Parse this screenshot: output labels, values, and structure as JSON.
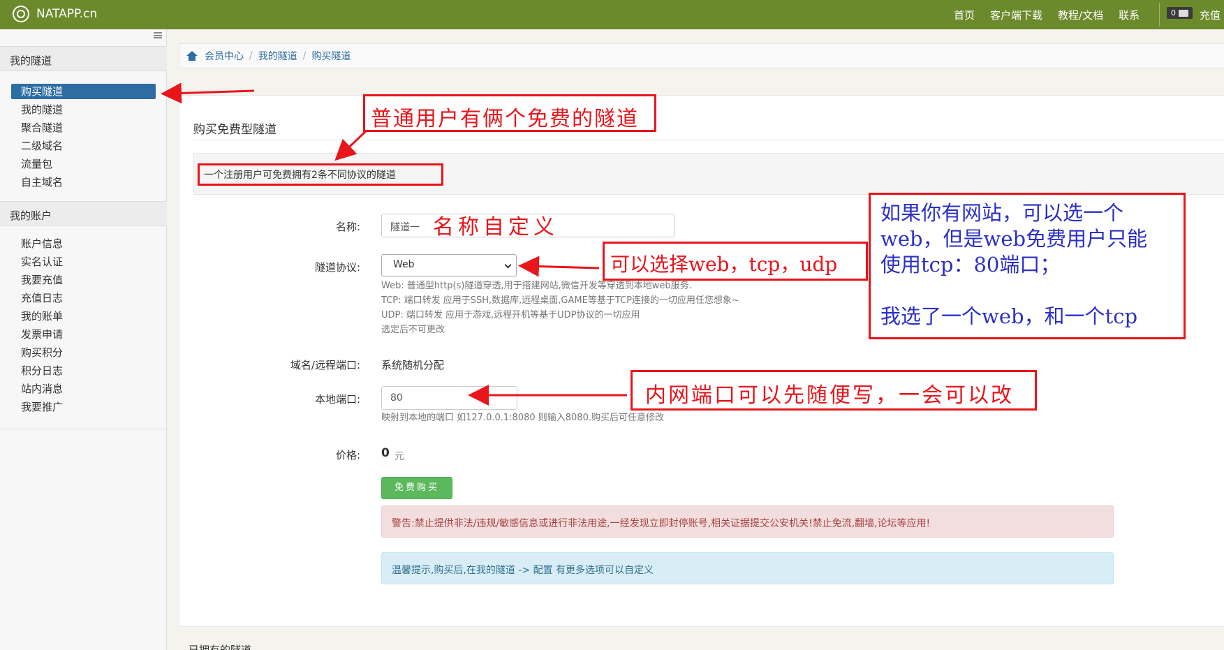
{
  "topbar": {
    "brand": "NATAPP.cn",
    "nav": [
      "首页",
      "客户端下载",
      "教程/文档",
      "联系"
    ],
    "badge_count": "0",
    "recharge": "充值"
  },
  "sidebar": {
    "section1": "我的隧道",
    "items1": [
      "购买隧道",
      "我的隧道",
      "聚合隧道",
      "二级域名",
      "流量包",
      "自主域名"
    ],
    "section2": "我的账户",
    "items2": [
      "账户信息",
      "实名认证",
      "我要充值",
      "充值日志",
      "我的账单",
      "发票申请",
      "购买积分",
      "积分日志",
      "站内消息",
      "我要推广"
    ]
  },
  "breadcrumb": [
    "会员中心",
    "我的隧道",
    "购买隧道"
  ],
  "form": {
    "title": "购买免费型隧道",
    "info": "一个注册用户可免费拥有2条不同协议的隧道",
    "name_label": "名称:",
    "name_value": "隧道一",
    "protocol_label": "隧道协议:",
    "protocol_value": "Web",
    "protocol_help": [
      "Web: 普通型http(s)隧道穿透,用于搭建网站,微信开发等穿透到本地web服务.",
      "TCP: 端口转发 应用于SSH,数据库,远程桌面,GAME等基于TCP连接的一切应用任您想象~",
      "UDP: 端口转发 应用于游戏,远程开机等基于UDP协议的一切应用",
      "选定后不可更改"
    ],
    "domain_label": "域名/远程端口:",
    "domain_value": "系统随机分配",
    "port_label": "本地端口:",
    "port_value": "80",
    "port_help": "映射到本地的端口 如127.0.0.1:8080 则输入8080.购买后可任意修改",
    "price_label": "价格:",
    "price_value": "0",
    "price_unit": "元",
    "buy_button": "免费购买",
    "warning": "警告:禁止提供非法/违规/敏感信息或进行非法用途,一经发现立即封停账号,相关证据提交公安机关!禁止免流,翻墙,论坛等应用!",
    "tip": "温馨提示,购买后,在我的隧道 -> 配置 有更多选项可以自定义",
    "below": "已拥有的隧道"
  },
  "annotations": {
    "free_tunnels": "普通用户有俩个免费的隧道",
    "name_custom": "名称自定义",
    "protocol_choice": "可以选择web，tcp，udp",
    "website_note": [
      "如果你有网站，可以选一个",
      "web，但是web免费用户只能",
      "使用tcp：80端口；",
      "",
      "我选了一个web，和一个tcp"
    ],
    "port_note": "内网端口可以先随便写，一会可以改"
  },
  "colors": {
    "topbar": "#6b8a2c",
    "annotation_red": "#e8151b",
    "annotation_blue": "#2b2fc7",
    "active": "#2e6da4"
  }
}
